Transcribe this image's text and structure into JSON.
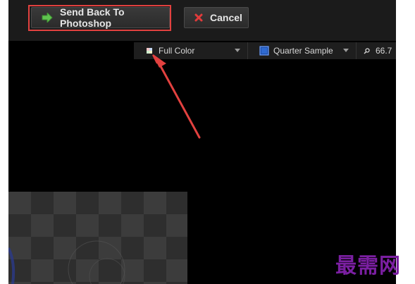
{
  "toolbar": {
    "send_label": "Send Back To Photoshop",
    "send_icon": "arrow-right-icon",
    "cancel_label": "Cancel",
    "cancel_icon": "close-x-icon"
  },
  "options": {
    "color_mode": "Full Color",
    "sample_mode": "Quarter Sample",
    "zoom": "66.7"
  },
  "annotation": {
    "highlight_color": "#e2413f"
  },
  "watermark": "最需网",
  "colors": {
    "accent_green": "#5fc44f",
    "cancel_red": "#e23b3b",
    "toolbar_bg": "#1b1b1b",
    "canvas_bg": "#000000"
  }
}
